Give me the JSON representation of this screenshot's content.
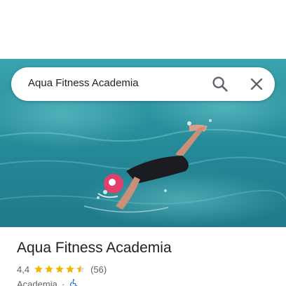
{
  "search": {
    "query": "Aqua Fitness Academia"
  },
  "place": {
    "name": "Aqua Fitness Academia",
    "rating": "4,4",
    "stars_filled": 4.5,
    "review_count": "(56)",
    "category": "Academia",
    "separator": "·"
  },
  "icons": {
    "search": "search-icon",
    "close": "close-icon",
    "star": "star-icon",
    "accessible": "wheelchair-accessible-icon"
  },
  "colors": {
    "star": "#f4b400",
    "star_empty": "#dadce0",
    "accessible": "#1a73e8",
    "water": "#2a8c9a"
  }
}
